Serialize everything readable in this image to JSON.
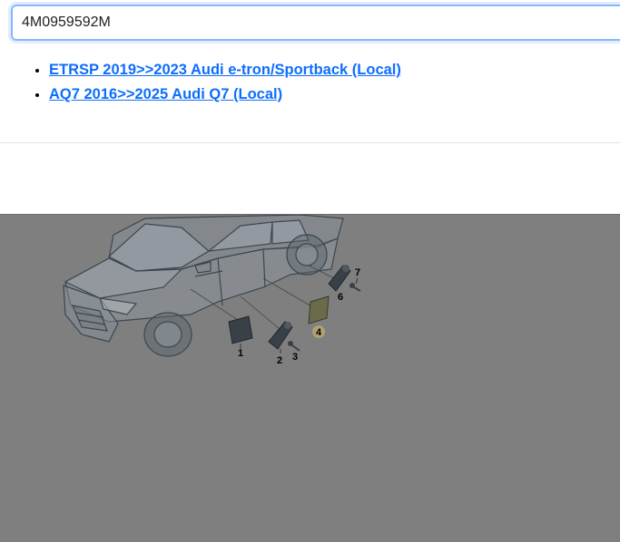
{
  "search": {
    "value": "4M0959592M"
  },
  "results": [
    {
      "label": "ETRSP 2019>>2023 Audi e-tron/Sportback (Local)"
    },
    {
      "label": "AQ7 2016>>2025 Audi Q7 (Local)"
    }
  ],
  "diagram": {
    "callouts": [
      "1",
      "2",
      "3",
      "4",
      "6",
      "7"
    ]
  },
  "colors": {
    "link": "#0d6efd",
    "focus_border": "#86b7fe",
    "overlay": "#7f7f7f",
    "highlight": "#d8bf6a"
  }
}
